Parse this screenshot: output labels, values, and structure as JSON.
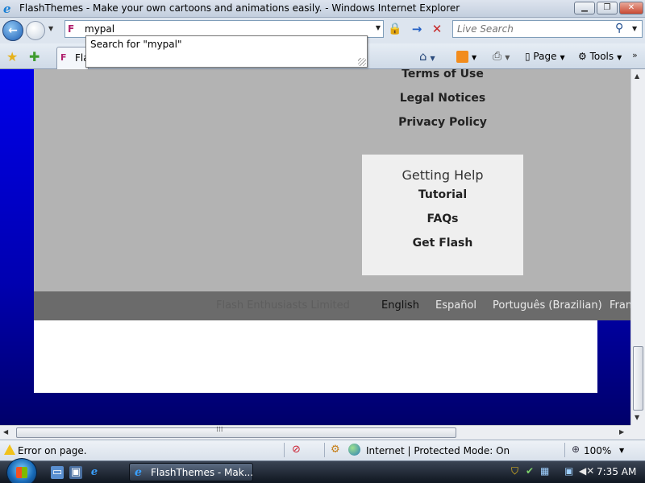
{
  "window": {
    "title": "FlashThemes - Make your own cartoons and animations easily. - Windows Internet Explorer",
    "min_glyph": "▁",
    "max_glyph": "❐",
    "close_glyph": "✕"
  },
  "navbar": {
    "back_glyph": "←",
    "address_value": "mypal",
    "search_placeholder": "Live Search",
    "go_glyph": "→",
    "stop_glyph": "✕"
  },
  "autocomplete": {
    "suggestion": "Search for \"mypal\""
  },
  "commandbar": {
    "tab_label": "Fla",
    "page_label": "Page",
    "tools_label": "Tools"
  },
  "content": {
    "footer_links": [
      "Terms of Use",
      "Legal Notices",
      "Privacy Policy"
    ],
    "help": {
      "heading": "Getting Help",
      "links": [
        "Tutorial",
        "FAQs",
        "Get Flash"
      ]
    },
    "copyright": "Flash Enthusiasts Limited",
    "languages": [
      "English",
      "Español",
      "Português (Brazilian)",
      "Fran"
    ],
    "active_language": "English"
  },
  "statusbar": {
    "message": "Error on page.",
    "zone": "Internet | Protected Mode: On",
    "zoom": "100%"
  },
  "taskbar": {
    "window_button": "FlashThemes - Mak...",
    "clock": "7:35 AM"
  },
  "colors": {
    "page_background_top": "#0000ea",
    "page_background_bottom": "#00006a",
    "content_gray": "#b3b3b3",
    "footer_bar": "#6b6b6b"
  },
  "icons": [
    "favorites-star-icon",
    "add-favorite-icon",
    "home-icon",
    "feeds-icon",
    "print-icon",
    "lock-icon",
    "search-icon",
    "warning-icon",
    "globe-icon",
    "windows-flag-icon",
    "ie-logo-icon"
  ]
}
